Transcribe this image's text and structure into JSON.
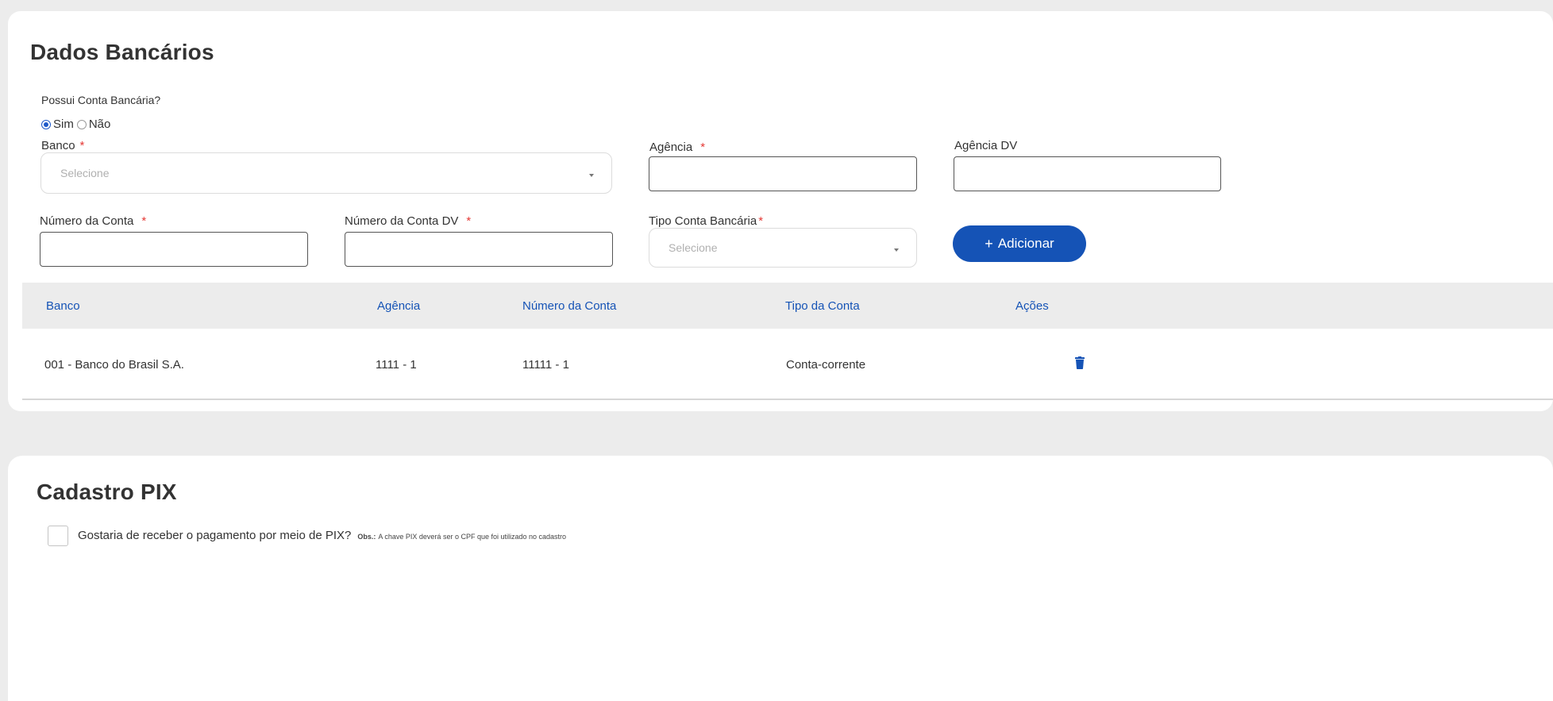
{
  "bank_section": {
    "title": "Dados Bancários",
    "has_account_label": "Possui Conta Bancária?",
    "radio_yes": "Sim",
    "radio_no": "Não",
    "selected": "Sim",
    "banco_label": "Banco",
    "agencia_label": "Agência",
    "agencia_dv_label": "Agência DV",
    "numero_conta_label": "Número da Conta",
    "numero_conta_dv_label": "Número da Conta DV",
    "tipo_conta_label": "Tipo Conta Bancária",
    "required_mark": "*",
    "select_placeholder": "Selecione",
    "add_button": "Adicionar",
    "add_button_icon": "plus-icon",
    "table": {
      "headers": [
        "Banco",
        "Agência",
        "Número da Conta",
        "Tipo da Conta",
        "Ações"
      ],
      "rows": [
        {
          "banco": "001 - Banco do Brasil S.A.",
          "agencia": "1111 - 1",
          "conta": "11111 - 1",
          "tipo": "Conta-corrente",
          "action_icon": "trash-icon"
        }
      ]
    }
  },
  "pix_section": {
    "title": "Cadastro PIX",
    "checkbox_label": "Gostaria de receber o pagamento por meio de PIX?",
    "obs_label": "Obs.:",
    "obs_text": "A chave PIX deverá ser o CPF que foi utilizado no cadastro",
    "checked": false
  },
  "colors": {
    "primary": "#1553b6",
    "required": "#e53935",
    "header_bg": "#ececec",
    "page_bg": "#ececec"
  }
}
